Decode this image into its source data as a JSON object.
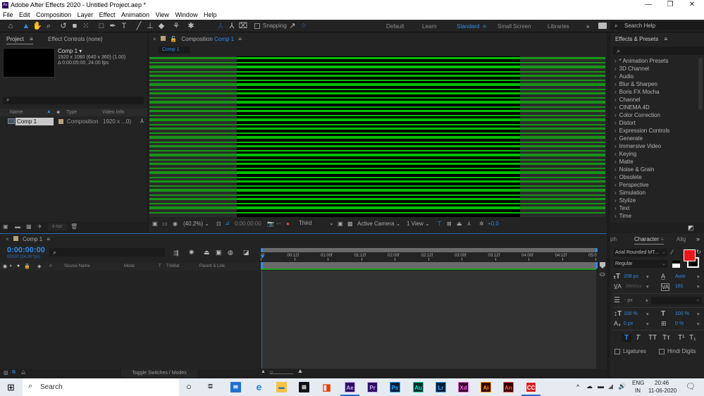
{
  "window": {
    "title": "Adobe After Effects 2020 - Untitled Project.aep *",
    "app_icon": "Ae",
    "controls": [
      "—",
      "❐",
      "✕"
    ]
  },
  "menu": [
    "File",
    "Edit",
    "Composition",
    "Layer",
    "Effect",
    "Animation",
    "View",
    "Window",
    "Help"
  ],
  "toolbar": {
    "tools": [
      "home-icon",
      "selection-tool-icon",
      "hand-tool-icon",
      "zoom-tool-icon",
      "rotation-tool-icon",
      "camera-tool-icon",
      "pan-behind-tool-icon",
      "rectangle-tool-icon",
      "pen-tool-icon",
      "type-tool-icon",
      "brush-tool-icon",
      "clone-stamp-tool-icon",
      "eraser-tool-icon",
      "roto-brush-tool-icon",
      "puppet-pin-tool-icon"
    ],
    "snapping_label": "Snapping",
    "workspaces": [
      {
        "label": "Default",
        "active": false
      },
      {
        "label": "Learn",
        "active": false
      },
      {
        "label": "Standard",
        "active": true
      },
      {
        "label": "Small Screen",
        "active": false
      },
      {
        "label": "Libraries",
        "active": false
      }
    ],
    "overflow": "»",
    "search_help_placeholder": "Search Help"
  },
  "project": {
    "tab_label": "Project",
    "tab2_label": "Effect Controls (none)",
    "item_name": "Comp 1",
    "item_res": "1920 x 1080  (640 x 360) (1.00)",
    "item_duration": "Δ 0:00:05:00, 24.00 fps",
    "columns": [
      "Name",
      "Type",
      "Video Info"
    ],
    "rows": [
      {
        "name": "Comp 1",
        "type": "Composition",
        "video_info": "1920 x ...0)"
      }
    ],
    "bpc": "8 bpc"
  },
  "composition": {
    "tab_prefix": "Composition",
    "tab_name": "Comp 1",
    "sub_tab": "Comp 1",
    "zoom": "(40.2%)",
    "timecode": "0:00:00:00",
    "resolution": "Third",
    "camera": "Active Camera",
    "views": "1 View",
    "exposure": "+0.0"
  },
  "effects": {
    "tab_label": "Effects & Presets",
    "items": [
      "* Animation Presets",
      "3D Channel",
      "Audio",
      "Blur & Sharpen",
      "Boris FX Mocha",
      "Channel",
      "CINEMA 4D",
      "Color Correction",
      "Distort",
      "Expression Controls",
      "Generate",
      "Immersive Video",
      "Keying",
      "Matte",
      "Noise & Grain",
      "Obsolete",
      "Perspective",
      "Simulation",
      "Stylize",
      "Text",
      "Time"
    ]
  },
  "timeline": {
    "tab_label": "Comp 1",
    "timecode": "0:00:00:00",
    "frames": "00000 (24.00 fps)",
    "columns": [
      "#",
      "Source Name",
      "Mode",
      "T",
      "TrkMat",
      "Parent & Link"
    ],
    "ruler": [
      "0f",
      "00:12f",
      "01:00f",
      "01:12f",
      "02:00f",
      "02:12f",
      "03:00f",
      "03:12f",
      "04:00f",
      "04:12f",
      "05:0"
    ],
    "toggle_label": "Toggle Switches / Modes"
  },
  "character": {
    "tab_prev": "ph",
    "tab_label": "Character",
    "tab_next": "Alig",
    "font": "Arial Rounded MT...",
    "style": "Regular",
    "font_size": "208 px",
    "leading": "Auto",
    "kerning": "Metrics",
    "tracking": "181",
    "line_spacing_unit": "- px",
    "vertical_scale": "100 %",
    "horizontal_scale": "100 %",
    "baseline_shift": "0 px",
    "tsume": "0 %",
    "style_buttons": [
      "T",
      "T",
      "TT",
      "Tт",
      "T¹",
      "T₁"
    ],
    "ligatures_label": "Ligatures",
    "hindi_digits_label": "Hindi Digits",
    "fill_color": "#e8171b"
  },
  "taskbar": {
    "search_placeholder": "Search",
    "apps": [
      {
        "label": "Ae",
        "bg": "#2a0f5e",
        "fg": "#c9a8ff"
      },
      {
        "label": "Pr",
        "bg": "#2a0f5e",
        "fg": "#d7a8ff"
      },
      {
        "label": "Ps",
        "bg": "#001d34",
        "fg": "#31a8ff"
      },
      {
        "label": "Au",
        "bg": "#00302a",
        "fg": "#00e4bb"
      },
      {
        "label": "Lr",
        "bg": "#001d34",
        "fg": "#31a8ff"
      },
      {
        "label": "Xd",
        "bg": "#2e001f",
        "fg": "#ff61f6"
      },
      {
        "label": "Ai",
        "bg": "#330000",
        "fg": "#ff9a00"
      },
      {
        "label": "An",
        "bg": "#330000",
        "fg": "#ff5a3a"
      },
      {
        "label": "CC",
        "bg": "#da1f26",
        "fg": "#ffffff"
      }
    ],
    "lang": "ENG",
    "region": "IN",
    "time": "20:46",
    "date": "11-06-2020"
  }
}
